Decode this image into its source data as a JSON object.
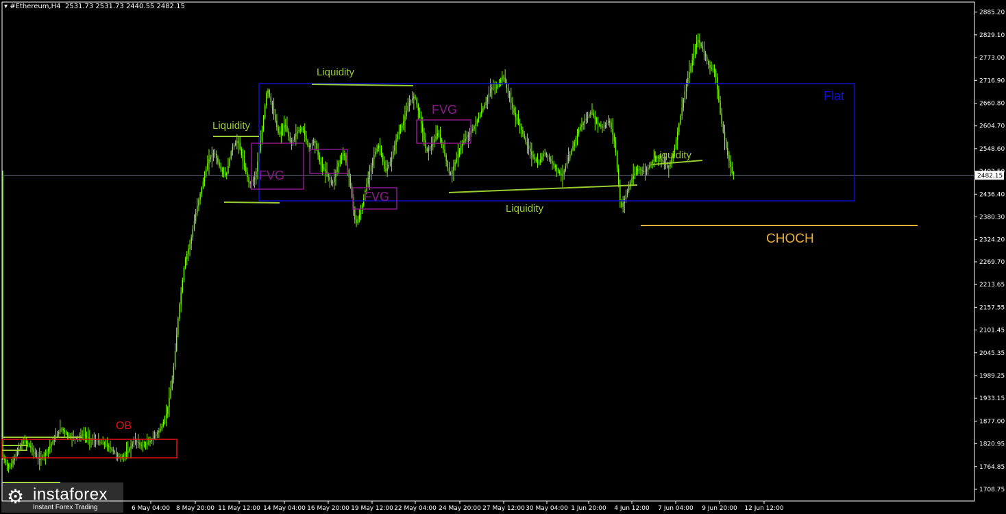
{
  "header": {
    "menu_glyph": "▾",
    "symbol": "#Ethereum,H4",
    "ohlc": "2531.73 2531.73 2440.55 2482.15"
  },
  "chart_data": {
    "type": "candlestick",
    "ylim": [
      1680,
      2910
    ],
    "y_ticks": [
      "2885.20",
      "2829.10",
      "2773.00",
      "2716.90",
      "2660.80",
      "2604.70",
      "2548.60",
      "2492.50",
      "2436.40",
      "2380.30",
      "2324.20",
      "2269.70",
      "2213.65",
      "2157.55",
      "2101.45",
      "2045.35",
      "1989.25",
      "1933.15",
      "1877.00",
      "1820.95",
      "1764.85",
      "1708.75"
    ],
    "x_ticks": [
      "6 May 04:00",
      "8 May 20:00",
      "11 May 12:00",
      "14 May 04:00",
      "16 May 20:00",
      "19 May 12:00",
      "22 May 04:00",
      "24 May 20:00",
      "27 May 12:00",
      "30 May 04:00",
      "1 Jun 20:00",
      "4 Jun 12:00",
      "7 Jun 04:00",
      "9 Jun 20:00",
      "12 Jun 12:00"
    ],
    "current_price": "2482.15",
    "price_path": [
      [
        0,
        1790
      ],
      [
        5,
        1760
      ],
      [
        10,
        1800
      ],
      [
        15,
        1830
      ],
      [
        20,
        1810
      ],
      [
        25,
        1780
      ],
      [
        30,
        1800
      ],
      [
        35,
        1830
      ],
      [
        40,
        1860
      ],
      [
        45,
        1840
      ],
      [
        50,
        1835
      ],
      [
        55,
        1845
      ],
      [
        60,
        1830
      ],
      [
        65,
        1825
      ],
      [
        70,
        1820
      ],
      [
        75,
        1805
      ],
      [
        80,
        1785
      ],
      [
        85,
        1800
      ],
      [
        90,
        1830
      ],
      [
        95,
        1815
      ],
      [
        100,
        1825
      ],
      [
        108,
        1860
      ],
      [
        112,
        1900
      ],
      [
        116,
        1990
      ],
      [
        120,
        2150
      ],
      [
        124,
        2270
      ],
      [
        128,
        2320
      ],
      [
        132,
        2400
      ],
      [
        136,
        2460
      ],
      [
        140,
        2520
      ],
      [
        144,
        2540
      ],
      [
        148,
        2500
      ],
      [
        152,
        2480
      ],
      [
        156,
        2550
      ],
      [
        160,
        2570
      ],
      [
        164,
        2510
      ],
      [
        168,
        2460
      ],
      [
        172,
        2480
      ],
      [
        176,
        2580
      ],
      [
        180,
        2700
      ],
      [
        184,
        2640
      ],
      [
        188,
        2580
      ],
      [
        192,
        2610
      ],
      [
        196,
        2560
      ],
      [
        200,
        2590
      ],
      [
        204,
        2600
      ],
      [
        208,
        2550
      ],
      [
        212,
        2570
      ],
      [
        216,
        2510
      ],
      [
        220,
        2490
      ],
      [
        224,
        2460
      ],
      [
        228,
        2510
      ],
      [
        232,
        2540
      ],
      [
        236,
        2470
      ],
      [
        240,
        2360
      ],
      [
        244,
        2400
      ],
      [
        248,
        2470
      ],
      [
        252,
        2530
      ],
      [
        256,
        2560
      ],
      [
        260,
        2490
      ],
      [
        264,
        2520
      ],
      [
        268,
        2580
      ],
      [
        272,
        2610
      ],
      [
        276,
        2660
      ],
      [
        280,
        2680
      ],
      [
        284,
        2620
      ],
      [
        288,
        2540
      ],
      [
        292,
        2560
      ],
      [
        296,
        2590
      ],
      [
        300,
        2540
      ],
      [
        304,
        2480
      ],
      [
        308,
        2520
      ],
      [
        312,
        2560
      ],
      [
        316,
        2580
      ],
      [
        320,
        2600
      ],
      [
        324,
        2630
      ],
      [
        328,
        2660
      ],
      [
        332,
        2700
      ],
      [
        336,
        2700
      ],
      [
        340,
        2730
      ],
      [
        344,
        2680
      ],
      [
        348,
        2630
      ],
      [
        352,
        2600
      ],
      [
        356,
        2560
      ],
      [
        360,
        2530
      ],
      [
        364,
        2510
      ],
      [
        368,
        2540
      ],
      [
        372,
        2520
      ],
      [
        376,
        2500
      ],
      [
        380,
        2480
      ],
      [
        384,
        2520
      ],
      [
        388,
        2560
      ],
      [
        392,
        2600
      ],
      [
        396,
        2620
      ],
      [
        400,
        2640
      ],
      [
        404,
        2610
      ],
      [
        408,
        2600
      ],
      [
        412,
        2620
      ],
      [
        416,
        2560
      ],
      [
        420,
        2400
      ],
      [
        424,
        2440
      ],
      [
        428,
        2480
      ],
      [
        432,
        2500
      ],
      [
        436,
        2490
      ],
      [
        440,
        2510
      ],
      [
        444,
        2530
      ],
      [
        448,
        2520
      ],
      [
        452,
        2500
      ],
      [
        456,
        2540
      ],
      [
        460,
        2620
      ],
      [
        464,
        2700
      ],
      [
        468,
        2760
      ],
      [
        472,
        2820
      ],
      [
        476,
        2790
      ],
      [
        480,
        2750
      ],
      [
        484,
        2740
      ],
      [
        488,
        2620
      ],
      [
        492,
        2540
      ],
      [
        496,
        2482
      ]
    ]
  },
  "annotations": {
    "ob": "OB",
    "liquidity": [
      "Liquidity",
      "Liquidity",
      "Liquidity",
      "Liquidity"
    ],
    "fvg": [
      "FVG",
      "FVG",
      "FVG"
    ],
    "flat": "Flat",
    "choch": "CHOCH"
  },
  "colors": {
    "candle": "#7CFC00",
    "liquidity": "#9ACD32",
    "fvg": "#8B1A8B",
    "flat": "#1010D0",
    "choch": "#E8B23A",
    "ob": "#E81010"
  },
  "watermark": {
    "logo_icon": "gear-icon",
    "name": "instaforex",
    "tagline": "Instant Forex Trading"
  }
}
